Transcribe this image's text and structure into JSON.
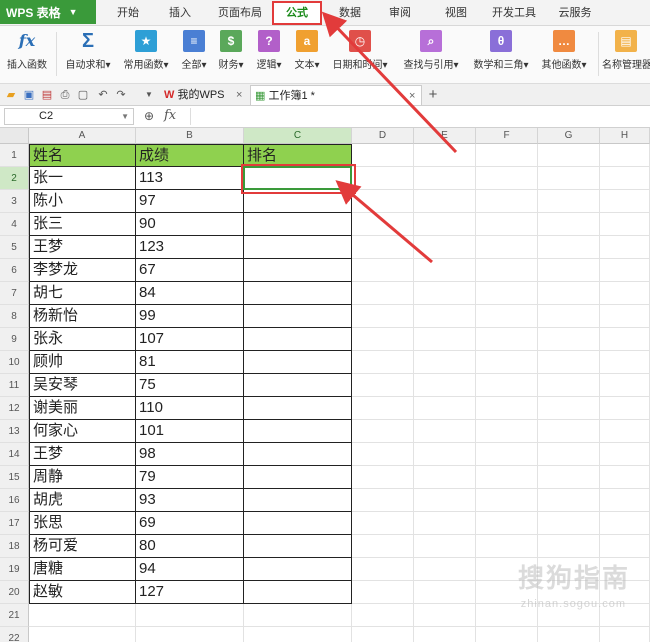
{
  "app": {
    "title": "WPS 表格"
  },
  "menu": [
    "开始",
    "插入",
    "页面布局",
    "公式",
    "数据",
    "审阅",
    "视图",
    "开发工具",
    "云服务"
  ],
  "ribbon": [
    {
      "icon": "fx-icon",
      "label": "插入函数"
    },
    {
      "icon": "sum-icon",
      "label": "自动求和▾"
    },
    {
      "icon": "star-icon",
      "label": "常用函数▾"
    },
    {
      "icon": "all-functions-icon",
      "label": "全部▾"
    },
    {
      "icon": "finance-icon",
      "label": "财务▾"
    },
    {
      "icon": "logic-icon",
      "label": "逻辑▾"
    },
    {
      "icon": "text-icon",
      "label": "文本▾"
    },
    {
      "icon": "clock-icon",
      "label": "日期和时间▾"
    },
    {
      "icon": "lookup-icon",
      "label": "查找与引用▾"
    },
    {
      "icon": "math-icon",
      "label": "数学和三角▾"
    },
    {
      "icon": "other-functions-icon",
      "label": "其他函数▾"
    },
    {
      "icon": "name-manager-icon",
      "label": "名称管理器"
    }
  ],
  "tabs": {
    "home": "我的WPS",
    "doc": "工作簿1 *",
    "close": "×",
    "add": "+"
  },
  "formula_bar": {
    "name_box": "C2",
    "fx": "fx",
    "value": ""
  },
  "columns": [
    "A",
    "B",
    "C",
    "D",
    "E",
    "F",
    "G",
    "H"
  ],
  "rows": [
    [
      "姓名",
      "成绩",
      "排名"
    ],
    [
      "张一",
      "113",
      ""
    ],
    [
      "陈小",
      "97",
      ""
    ],
    [
      "张三",
      "90",
      ""
    ],
    [
      "王梦",
      "123",
      ""
    ],
    [
      "李梦龙",
      "67",
      ""
    ],
    [
      "胡七",
      "84",
      ""
    ],
    [
      "杨新怡",
      "99",
      ""
    ],
    [
      "张永",
      "107",
      ""
    ],
    [
      "顾帅",
      "81",
      ""
    ],
    [
      "吴安琴",
      "75",
      ""
    ],
    [
      "谢美丽",
      "110",
      ""
    ],
    [
      "何家心",
      "101",
      ""
    ],
    [
      "王梦",
      "98",
      ""
    ],
    [
      "周静",
      "79",
      ""
    ],
    [
      "胡虎",
      "93",
      ""
    ],
    [
      "张思",
      "69",
      ""
    ],
    [
      "杨可爱",
      "80",
      ""
    ],
    [
      "唐糖",
      "94",
      ""
    ],
    [
      "赵敏",
      "127",
      ""
    ]
  ],
  "row_numbers": [
    "1",
    "2",
    "3",
    "4",
    "5",
    "6",
    "7",
    "8",
    "9",
    "10",
    "11",
    "12",
    "13",
    "14",
    "15",
    "16",
    "17",
    "18",
    "19",
    "20",
    "21",
    "22"
  ],
  "watermark": {
    "main": "搜狗指南",
    "sub": "zhinan.sogou.com"
  },
  "colors": {
    "accent": "#3a9a3a",
    "header_fill": "#8fd14f",
    "annotation": "#e23b3b"
  }
}
